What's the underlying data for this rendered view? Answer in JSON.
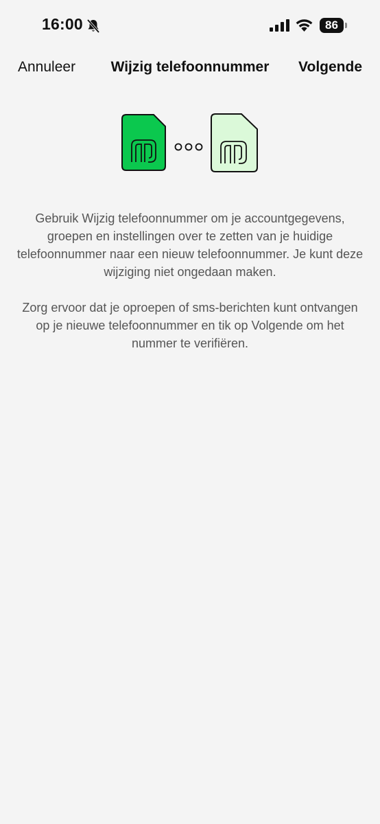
{
  "status_bar": {
    "time": "16:00",
    "battery_level": "86",
    "icons": [
      "bell-slash-icon",
      "cellular-signal-icon",
      "wifi-icon",
      "battery-icon"
    ]
  },
  "nav": {
    "cancel_label": "Annuleer",
    "title": "Wijzig telefoonnummer",
    "next_label": "Volgende"
  },
  "illustration": {
    "old_sim_color": "#0bc84e",
    "new_sim_color": "#dbf9d9",
    "icons": [
      "old-sim-card-icon",
      "transfer-dots-icon",
      "new-sim-card-icon"
    ]
  },
  "content": {
    "paragraph_1": "Gebruik Wijzig telefoonnummer om je accountgegevens, groepen en instellingen over te zetten van je huidige telefoonnummer naar een nieuw telefoonnummer. Je kunt deze wijziging niet ongedaan maken.",
    "paragraph_2": "Zorg ervoor dat je oproepen of sms-berichten kunt ontvangen op je nieuwe telefoonnummer en tik op Volgende om het nummer te verifiëren."
  }
}
